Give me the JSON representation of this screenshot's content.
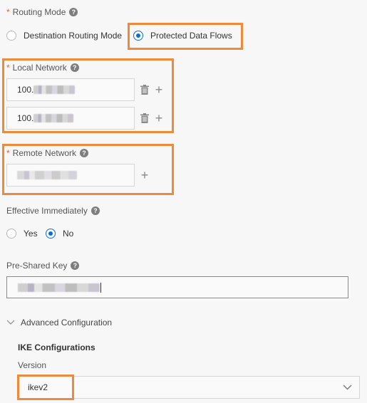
{
  "routing_mode": {
    "label": "Routing Mode",
    "required_mark": "*",
    "help_icon": "?",
    "options": [
      {
        "label": "Destination Routing Mode",
        "checked": false
      },
      {
        "label": "Protected Data Flows",
        "checked": true
      }
    ]
  },
  "local_network": {
    "label": "Local Network",
    "required_mark": "*",
    "help_icon": "?",
    "entries": [
      {
        "value_prefix": "100.",
        "value_redacted": true
      },
      {
        "value_prefix": "100.",
        "value_redacted": true
      }
    ],
    "add_icon": "+"
  },
  "remote_network": {
    "label": "Remote Network",
    "required_mark": "*",
    "help_icon": "?",
    "entries": [
      {
        "value_prefix": "",
        "value_redacted": true
      }
    ],
    "add_icon": "+"
  },
  "effective_immediately": {
    "label": "Effective Immediately",
    "help_icon": "?",
    "options": [
      {
        "label": "Yes",
        "checked": false
      },
      {
        "label": "No",
        "checked": true
      }
    ]
  },
  "pre_shared_key": {
    "label": "Pre-Shared Key",
    "help_icon": "?",
    "value_redacted": true
  },
  "advanced": {
    "toggle_label": "Advanced Configuration",
    "expanded": true,
    "ike": {
      "title": "IKE Configurations",
      "version_label": "Version",
      "version_value": "ikev2"
    }
  },
  "colors": {
    "highlight": "#ee8a3a",
    "radio_checked": "#0a6ed1",
    "required": "#e35a4b"
  }
}
